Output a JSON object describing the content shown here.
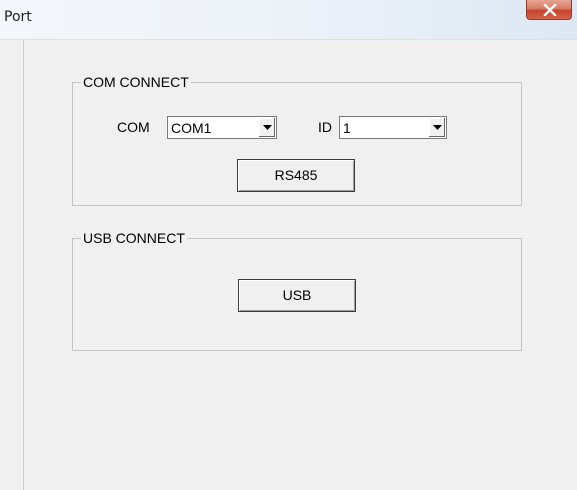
{
  "window": {
    "title": "Port",
    "close_label": "X"
  },
  "com_group": {
    "caption": "COM CONNECT",
    "com_label": "COM",
    "com_value": "COM1",
    "id_label": "ID",
    "id_value": "1",
    "button_label": "RS485"
  },
  "usb_group": {
    "caption": "USB CONNECT",
    "button_label": "USB"
  }
}
